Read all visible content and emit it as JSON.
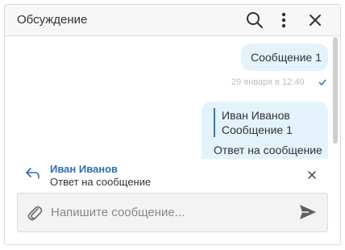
{
  "header": {
    "title": "Обсуждение",
    "icons": [
      "search-icon",
      "more-vertical-icon",
      "close-icon"
    ]
  },
  "messages": [
    {
      "text": "Сообщение 1",
      "timestamp": "29 января в 12:40",
      "status_icon": "check-icon"
    },
    {
      "quote": {
        "author": "Иван Иванов",
        "text": "Сообщение 1"
      },
      "text": "Ответ на сообщение"
    }
  ],
  "reply_preview": {
    "icon": "reply-icon",
    "author": "Иван Иванов",
    "text": "Ответ на сообщение"
  },
  "composer": {
    "value": "",
    "placeholder": "Напишите сообщение...",
    "icons": [
      "paperclip-icon",
      "send-icon"
    ]
  },
  "colors": {
    "bubble": "#e4f2fb",
    "accent": "#2f6fb0",
    "quote_bar": "#3b77ad",
    "header_bg": "#f7f7f7",
    "composer_bg": "#f3f3f3"
  }
}
